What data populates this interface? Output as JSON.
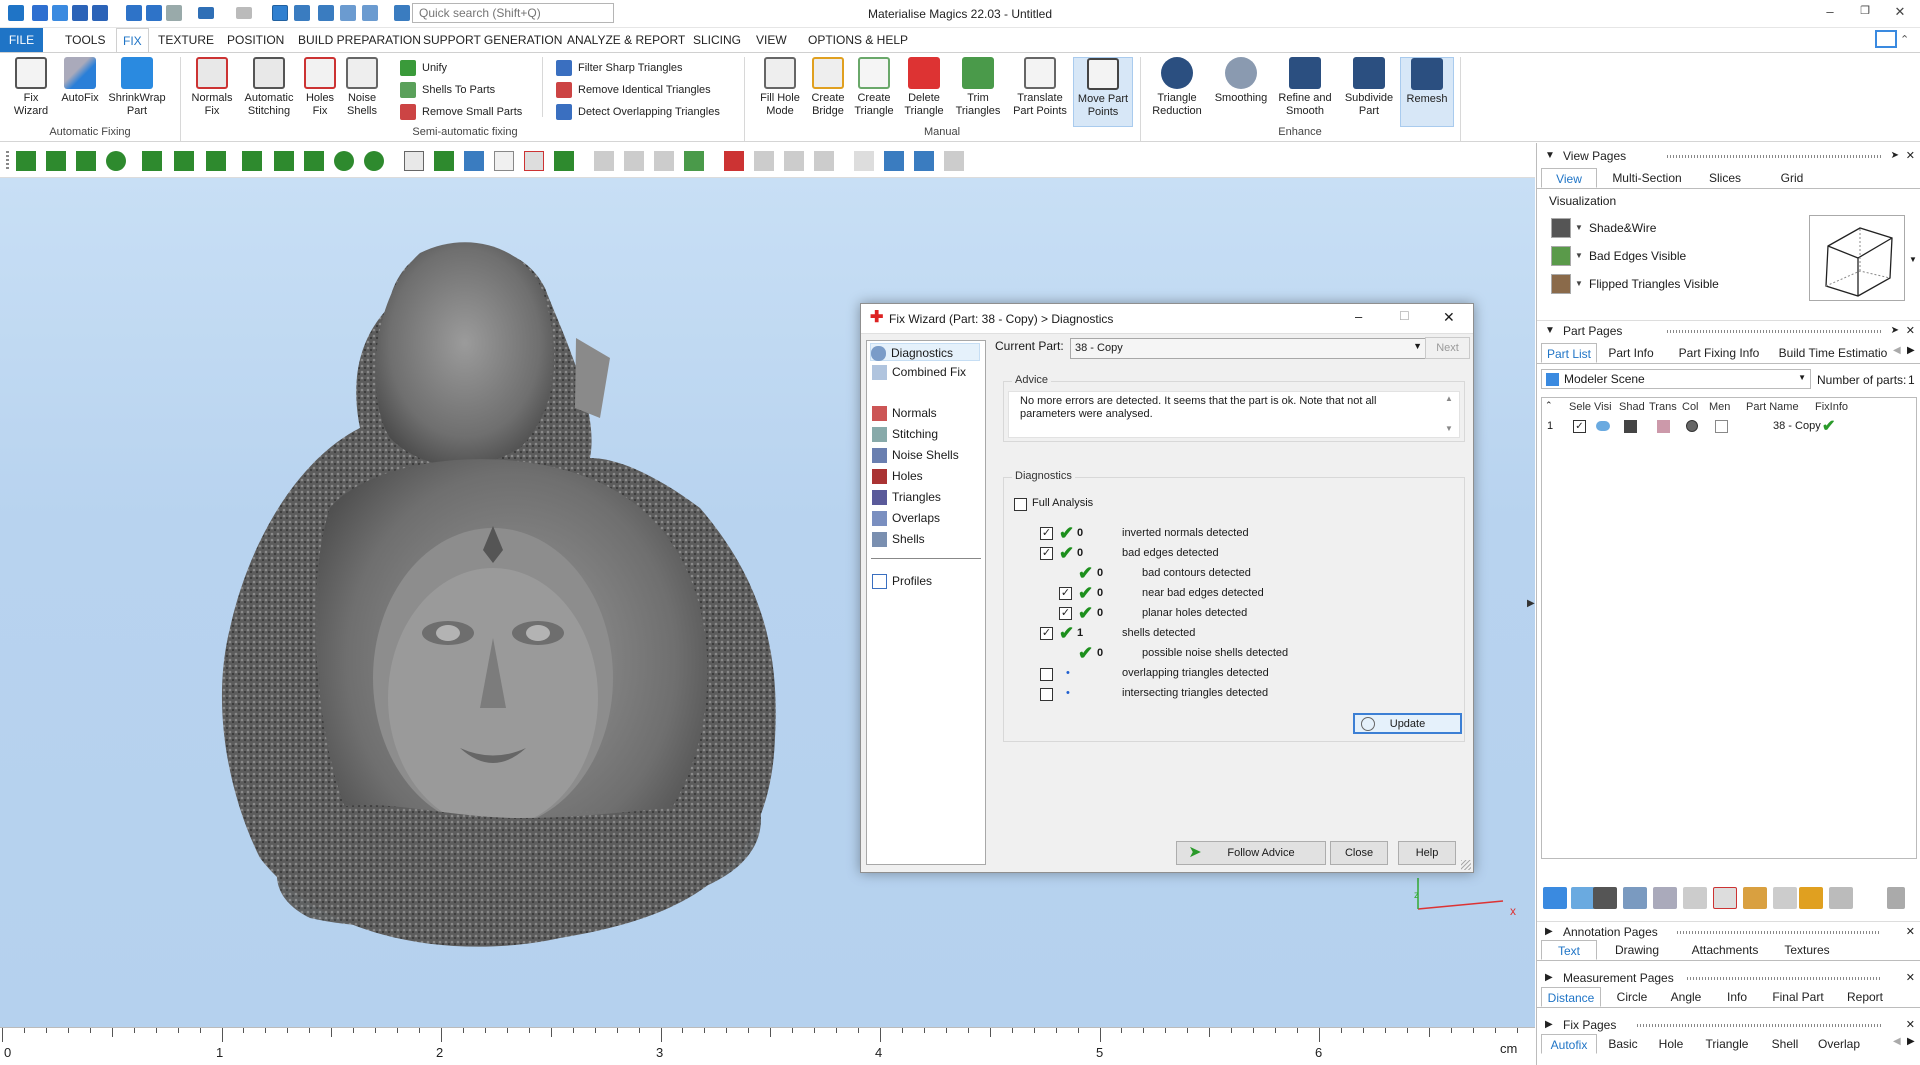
{
  "window": {
    "title": "Materialise Magics 22.03 - Untitled",
    "search_placeholder": "Quick search (Shift+Q)"
  },
  "menu": [
    "FILE",
    "TOOLS",
    "FIX",
    "TEXTURE",
    "POSITION",
    "BUILD PREPARATION",
    "SUPPORT GENERATION",
    "ANALYZE & REPORT",
    "SLICING",
    "VIEW",
    "OPTIONS & HELP"
  ],
  "ribbon": {
    "automatic_fixing": {
      "label": "Automatic Fixing",
      "buttons": [
        {
          "l1": "Fix",
          "l2": "Wizard"
        },
        {
          "l1": "AutoFix",
          "l2": ""
        },
        {
          "l1": "ShrinkWrap",
          "l2": "Part"
        }
      ]
    },
    "semi_automatic": {
      "label": "Semi-automatic fixing",
      "buttons": [
        {
          "l1": "Normals",
          "l2": "Fix"
        },
        {
          "l1": "Automatic",
          "l2": "Stitching"
        },
        {
          "l1": "Holes",
          "l2": "Fix"
        },
        {
          "l1": "Noise",
          "l2": "Shells"
        }
      ],
      "small": [
        "Unify",
        "Shells To Parts",
        "Remove Small Parts"
      ],
      "small2": [
        "Filter Sharp Triangles",
        "Remove Identical Triangles",
        "Detect Overlapping Triangles"
      ]
    },
    "manual": {
      "label": "Manual",
      "buttons": [
        {
          "l1": "Fill Hole",
          "l2": "Mode"
        },
        {
          "l1": "Create",
          "l2": "Bridge"
        },
        {
          "l1": "Create",
          "l2": "Triangle"
        },
        {
          "l1": "Delete",
          "l2": "Triangle"
        },
        {
          "l1": "Trim",
          "l2": "Triangles"
        },
        {
          "l1": "Translate",
          "l2": "Part Points"
        },
        {
          "l1": "Move Part",
          "l2": "Points"
        }
      ]
    },
    "enhance": {
      "label": "Enhance",
      "buttons": [
        {
          "l1": "Triangle",
          "l2": "Reduction"
        },
        {
          "l1": "Smoothing",
          "l2": ""
        },
        {
          "l1": "Refine and",
          "l2": "Smooth"
        },
        {
          "l1": "Subdivide",
          "l2": "Part"
        },
        {
          "l1": "Remesh",
          "l2": ""
        }
      ]
    }
  },
  "ruler": {
    "labels": [
      "0",
      "1",
      "2",
      "3",
      "4",
      "5",
      "6"
    ],
    "unit": "cm"
  },
  "dialog": {
    "title": "Fix Wizard (Part: 38 - Copy) > Diagnostics",
    "nav": [
      "Diagnostics",
      "Combined Fix",
      "Normals",
      "Stitching",
      "Noise Shells",
      "Holes",
      "Triangles",
      "Overlaps",
      "Shells",
      "Profiles"
    ],
    "current_part_label": "Current Part:",
    "current_part_value": "38 - Copy",
    "next_label": "Next",
    "advice_legend": "Advice",
    "advice_text": "No more errors are detected. It seems that the part is ok. Note that not all parameters were analysed.",
    "diagnostics_legend": "Diagnostics",
    "full_analysis": "Full Analysis",
    "rows": [
      {
        "count": "0",
        "label": "inverted normals detected"
      },
      {
        "count": "0",
        "label": "bad edges detected"
      },
      {
        "count": "0",
        "label": "bad contours detected"
      },
      {
        "count": "0",
        "label": "near bad edges detected"
      },
      {
        "count": "0",
        "label": "planar holes detected"
      },
      {
        "count": "1",
        "label": "shells detected"
      },
      {
        "count": "0",
        "label": "possible noise shells detected"
      },
      {
        "count": "",
        "label": "overlapping triangles detected"
      },
      {
        "count": "",
        "label": "intersecting triangles detected"
      }
    ],
    "update": "Update",
    "follow_advice": "Follow Advice",
    "close": "Close",
    "help": "Help"
  },
  "right_panel": {
    "view_pages": {
      "title": "View Pages",
      "tabs": [
        "View",
        "Multi-Section",
        "Slices",
        "Grid"
      ],
      "visualization": "Visualization",
      "options": [
        "Shade&Wire",
        "Bad Edges Visible",
        "Flipped Triangles Visible"
      ]
    },
    "part_pages": {
      "title": "Part Pages",
      "tabs": [
        "Part List",
        "Part Info",
        "Part Fixing Info",
        "Build Time Estimatio"
      ],
      "scene": "Modeler Scene",
      "num_parts_label": "Number of parts:",
      "num_parts": "1",
      "columns": [
        "Sele",
        "Visi",
        "Shad",
        "Trans",
        "Col",
        "Men",
        "Part Name",
        "FixInfo"
      ],
      "row": {
        "index": "1",
        "name": "38 - Copy"
      }
    },
    "annotation_pages": {
      "title": "Annotation Pages",
      "tabs": [
        "Text",
        "Drawing",
        "Attachments",
        "Textures"
      ]
    },
    "measurement_pages": {
      "title": "Measurement Pages",
      "tabs": [
        "Distance",
        "Circle",
        "Angle",
        "Info",
        "Final Part",
        "Report"
      ]
    },
    "fix_pages": {
      "title": "Fix Pages",
      "tabs": [
        "Autofix",
        "Basic",
        "Hole",
        "Triangle",
        "Shell",
        "Overlap"
      ]
    }
  }
}
